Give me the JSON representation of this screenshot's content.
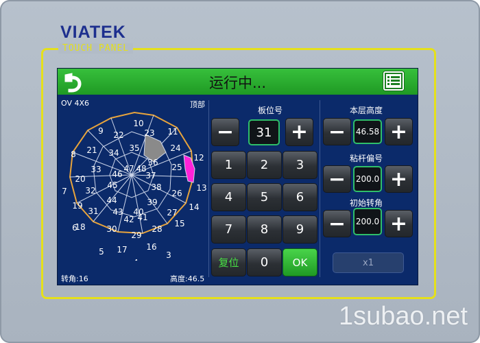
{
  "brand": {
    "main": "VIATEK",
    "panel_label": "TOUCH PANEL"
  },
  "titlebar": {
    "title": "运行中...",
    "back_icon": "back-arrow-icon",
    "menu_icon": "list-menu-icon",
    "color": "#29b02e"
  },
  "wafer": {
    "layout_label": "OV 4X6",
    "top_label": "顶部",
    "rotation_label": "转角:16",
    "height_label": "高度:46.5",
    "outer_numbers": [
      "10",
      "11",
      "12",
      "13",
      "14",
      "15",
      "3",
      "4",
      "5",
      "6",
      "7",
      "8",
      "9"
    ],
    "cells": [
      "23",
      "22",
      "24",
      "35",
      "34",
      "25",
      "21",
      "36",
      "37",
      "47",
      "48",
      "33",
      "38",
      "46",
      "45",
      "26",
      "20",
      "32",
      "39",
      "44",
      "27",
      "19",
      "31",
      "40",
      "43",
      "28",
      "42",
      "41",
      "18",
      "30",
      "29",
      "17",
      "16"
    ],
    "selected_cell": "24",
    "highlight_cell": "12",
    "selected_color": "#8a8a8a",
    "highlight_color": "#ff22d8"
  },
  "board_position": {
    "label": "板位号",
    "value": "31",
    "keys": [
      "1",
      "2",
      "3",
      "4",
      "5",
      "6",
      "7",
      "8",
      "9",
      "0"
    ],
    "reset_label": "复位",
    "ok_label": "OK",
    "minus": "−",
    "plus": "+"
  },
  "layer_height": {
    "label": "本层高度",
    "value": "46.58"
  },
  "rod_offset": {
    "label": "粘杆偏号",
    "value": "200.0"
  },
  "initial_angle": {
    "label": "初始转角",
    "value": "200.0"
  },
  "step_button": {
    "label": "x1"
  },
  "watermark": "1subao.net"
}
